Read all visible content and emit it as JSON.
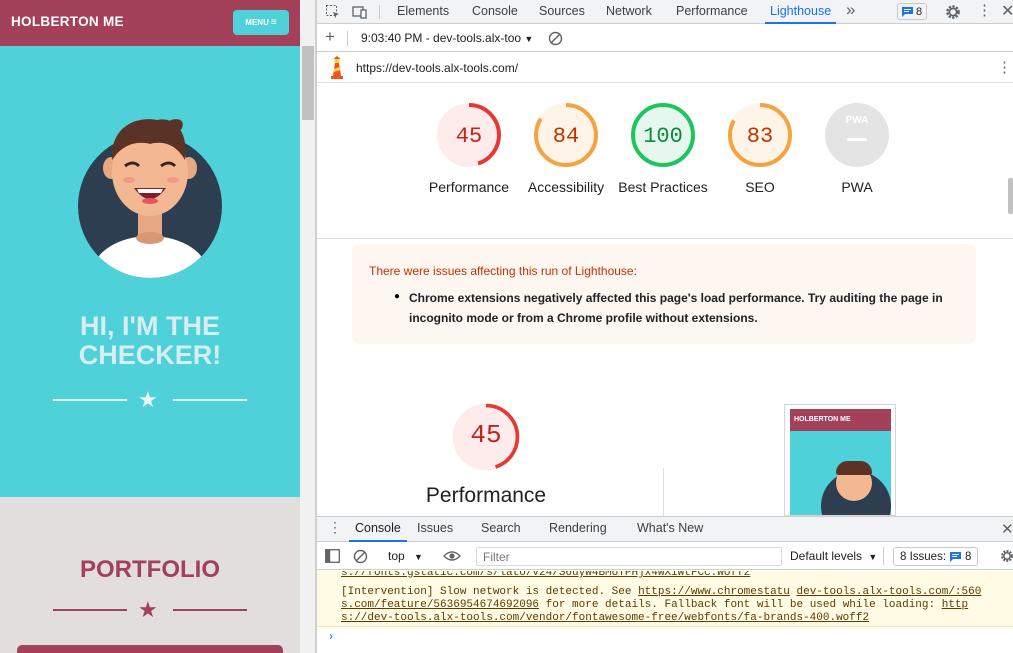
{
  "site": {
    "brand": "HOLBERTON ME",
    "menu_label": "MENU",
    "hero_title_line1": "HI, I'M THE",
    "hero_title_line2": "CHECKER!",
    "portfolio_title": "PORTFOLIO",
    "colors": {
      "primary": "#a3405a",
      "teal": "#4fd1d9",
      "grey": "#e2dedd"
    }
  },
  "devtools": {
    "tabs": [
      "Elements",
      "Console",
      "Sources",
      "Network",
      "Performance",
      "Lighthouse"
    ],
    "active_tab": "Lighthouse",
    "issues_count": "8",
    "report_selector": "9:03:40 PM - dev-tools.alx-too",
    "url": "https://dev-tools.alx-tools.com/",
    "scores": [
      {
        "value": "45",
        "label": "Performance",
        "score": 45,
        "color": "#e53935",
        "bg": "#fdeceb",
        "text": "#c5221f"
      },
      {
        "value": "84",
        "label": "Accessibility",
        "score": 84,
        "color": "#f4a340",
        "bg": "#fef4e7",
        "text": "#c33300"
      },
      {
        "value": "100",
        "label": "Best Practices",
        "score": 100,
        "color": "#1ec45d",
        "bg": "#e6f8ed",
        "text": "#0d8a3c"
      },
      {
        "value": "83",
        "label": "SEO",
        "score": 83,
        "color": "#f4a340",
        "bg": "#fef4e7",
        "text": "#c33300"
      },
      {
        "value": "PWA",
        "label": "PWA",
        "score": 0,
        "color": "#d9d9d9",
        "bg": "#e8e8e8",
        "text": "#ffffff"
      }
    ],
    "warning": {
      "title": "There were issues affecting this run of Lighthouse:",
      "item": "Chrome extensions negatively affected this page's load performance. Try auditing the page in incognito mode or from a Chrome profile without extensions."
    },
    "big_score": {
      "value": "45",
      "label": "Performance"
    },
    "thumbnail_brand": "HOLBERTON ME"
  },
  "drawer": {
    "tabs": [
      "Console",
      "Issues",
      "Search",
      "Rendering",
      "What's New"
    ],
    "active_tab": "Console",
    "context": "top",
    "filter_placeholder": "Filter",
    "levels": "Default levels",
    "issues_label": "8 Issues:",
    "issues_count": "8",
    "log_line0": "s://fonts.gstatic.com/s/lato/v24/S6uyw4BMUTPHjx4wXiWtFCc.woff2",
    "log_line1a": "[Intervention] Slow network is detected. See ",
    "log_link1": "https://www.chromestatu",
    "log_link2": "dev-tools.alx-tools.com/:560",
    "log_line2a": "s.com/feature/5636954674692096",
    "log_line2b": " for more details. Fallback font will be used while loading: ",
    "log_link3": "http",
    "log_line3": "s://dev-tools.alx-tools.com/vendor/fontawesome-free/webfonts/fa-brands-400.woff2",
    "prompt": "›"
  }
}
